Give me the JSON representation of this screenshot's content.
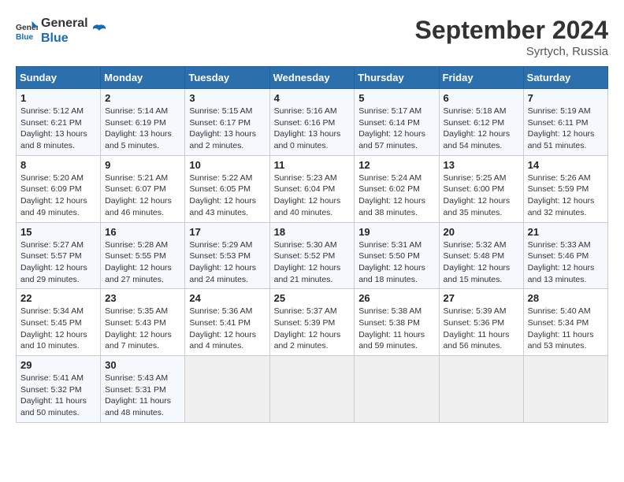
{
  "header": {
    "logo_general": "General",
    "logo_blue": "Blue",
    "month_title": "September 2024",
    "location": "Syrtych, Russia"
  },
  "columns": [
    "Sunday",
    "Monday",
    "Tuesday",
    "Wednesday",
    "Thursday",
    "Friday",
    "Saturday"
  ],
  "weeks": [
    [
      {
        "day": "1",
        "info": "Sunrise: 5:12 AM\nSunset: 6:21 PM\nDaylight: 13 hours\nand 8 minutes."
      },
      {
        "day": "2",
        "info": "Sunrise: 5:14 AM\nSunset: 6:19 PM\nDaylight: 13 hours\nand 5 minutes."
      },
      {
        "day": "3",
        "info": "Sunrise: 5:15 AM\nSunset: 6:17 PM\nDaylight: 13 hours\nand 2 minutes."
      },
      {
        "day": "4",
        "info": "Sunrise: 5:16 AM\nSunset: 6:16 PM\nDaylight: 13 hours\nand 0 minutes."
      },
      {
        "day": "5",
        "info": "Sunrise: 5:17 AM\nSunset: 6:14 PM\nDaylight: 12 hours\nand 57 minutes."
      },
      {
        "day": "6",
        "info": "Sunrise: 5:18 AM\nSunset: 6:12 PM\nDaylight: 12 hours\nand 54 minutes."
      },
      {
        "day": "7",
        "info": "Sunrise: 5:19 AM\nSunset: 6:11 PM\nDaylight: 12 hours\nand 51 minutes."
      }
    ],
    [
      {
        "day": "8",
        "info": "Sunrise: 5:20 AM\nSunset: 6:09 PM\nDaylight: 12 hours\nand 49 minutes."
      },
      {
        "day": "9",
        "info": "Sunrise: 5:21 AM\nSunset: 6:07 PM\nDaylight: 12 hours\nand 46 minutes."
      },
      {
        "day": "10",
        "info": "Sunrise: 5:22 AM\nSunset: 6:05 PM\nDaylight: 12 hours\nand 43 minutes."
      },
      {
        "day": "11",
        "info": "Sunrise: 5:23 AM\nSunset: 6:04 PM\nDaylight: 12 hours\nand 40 minutes."
      },
      {
        "day": "12",
        "info": "Sunrise: 5:24 AM\nSunset: 6:02 PM\nDaylight: 12 hours\nand 38 minutes."
      },
      {
        "day": "13",
        "info": "Sunrise: 5:25 AM\nSunset: 6:00 PM\nDaylight: 12 hours\nand 35 minutes."
      },
      {
        "day": "14",
        "info": "Sunrise: 5:26 AM\nSunset: 5:59 PM\nDaylight: 12 hours\nand 32 minutes."
      }
    ],
    [
      {
        "day": "15",
        "info": "Sunrise: 5:27 AM\nSunset: 5:57 PM\nDaylight: 12 hours\nand 29 minutes."
      },
      {
        "day": "16",
        "info": "Sunrise: 5:28 AM\nSunset: 5:55 PM\nDaylight: 12 hours\nand 27 minutes."
      },
      {
        "day": "17",
        "info": "Sunrise: 5:29 AM\nSunset: 5:53 PM\nDaylight: 12 hours\nand 24 minutes."
      },
      {
        "day": "18",
        "info": "Sunrise: 5:30 AM\nSunset: 5:52 PM\nDaylight: 12 hours\nand 21 minutes."
      },
      {
        "day": "19",
        "info": "Sunrise: 5:31 AM\nSunset: 5:50 PM\nDaylight: 12 hours\nand 18 minutes."
      },
      {
        "day": "20",
        "info": "Sunrise: 5:32 AM\nSunset: 5:48 PM\nDaylight: 12 hours\nand 15 minutes."
      },
      {
        "day": "21",
        "info": "Sunrise: 5:33 AM\nSunset: 5:46 PM\nDaylight: 12 hours\nand 13 minutes."
      }
    ],
    [
      {
        "day": "22",
        "info": "Sunrise: 5:34 AM\nSunset: 5:45 PM\nDaylight: 12 hours\nand 10 minutes."
      },
      {
        "day": "23",
        "info": "Sunrise: 5:35 AM\nSunset: 5:43 PM\nDaylight: 12 hours\nand 7 minutes."
      },
      {
        "day": "24",
        "info": "Sunrise: 5:36 AM\nSunset: 5:41 PM\nDaylight: 12 hours\nand 4 minutes."
      },
      {
        "day": "25",
        "info": "Sunrise: 5:37 AM\nSunset: 5:39 PM\nDaylight: 12 hours\nand 2 minutes."
      },
      {
        "day": "26",
        "info": "Sunrise: 5:38 AM\nSunset: 5:38 PM\nDaylight: 11 hours\nand 59 minutes."
      },
      {
        "day": "27",
        "info": "Sunrise: 5:39 AM\nSunset: 5:36 PM\nDaylight: 11 hours\nand 56 minutes."
      },
      {
        "day": "28",
        "info": "Sunrise: 5:40 AM\nSunset: 5:34 PM\nDaylight: 11 hours\nand 53 minutes."
      }
    ],
    [
      {
        "day": "29",
        "info": "Sunrise: 5:41 AM\nSunset: 5:32 PM\nDaylight: 11 hours\nand 50 minutes."
      },
      {
        "day": "30",
        "info": "Sunrise: 5:43 AM\nSunset: 5:31 PM\nDaylight: 11 hours\nand 48 minutes."
      },
      {
        "day": "",
        "info": ""
      },
      {
        "day": "",
        "info": ""
      },
      {
        "day": "",
        "info": ""
      },
      {
        "day": "",
        "info": ""
      },
      {
        "day": "",
        "info": ""
      }
    ]
  ]
}
